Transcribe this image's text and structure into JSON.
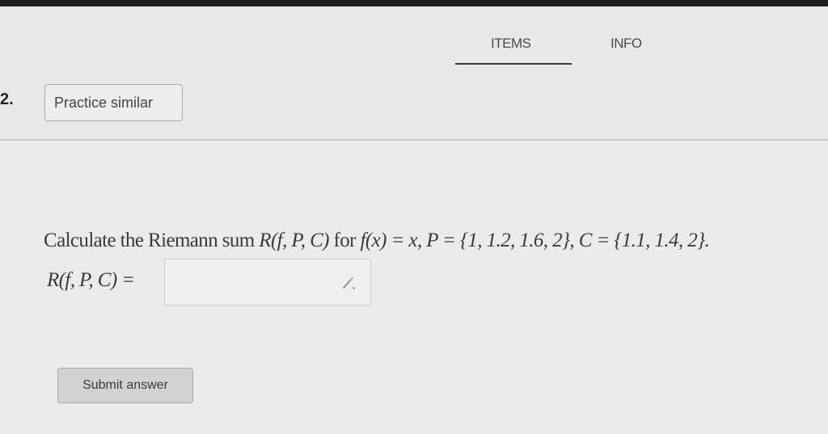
{
  "tabs": {
    "items_label": "ITEMS",
    "info_label": "INFO"
  },
  "question_number": "2.",
  "practice_button_label": "Practice similar",
  "question": {
    "prefix": "Calculate the Riemann sum ",
    "sum_expr": "R(f, P, C)",
    "for_word": " for ",
    "function_expr": "f(x) = x",
    "partition_expr": ", P = {1, 1.2, 1.6, 2}",
    "tags_expr": ", C = {1.1, 1.4, 2}."
  },
  "answer": {
    "label": "R(f, P, C) =",
    "value": "",
    "edit_icon": "pencil-icon"
  },
  "submit_label": "Submit answer",
  "colors": {
    "top_bar": "#1e1e1e",
    "background": "#e8e8e6",
    "tab_underline": "#3a3a3a"
  }
}
